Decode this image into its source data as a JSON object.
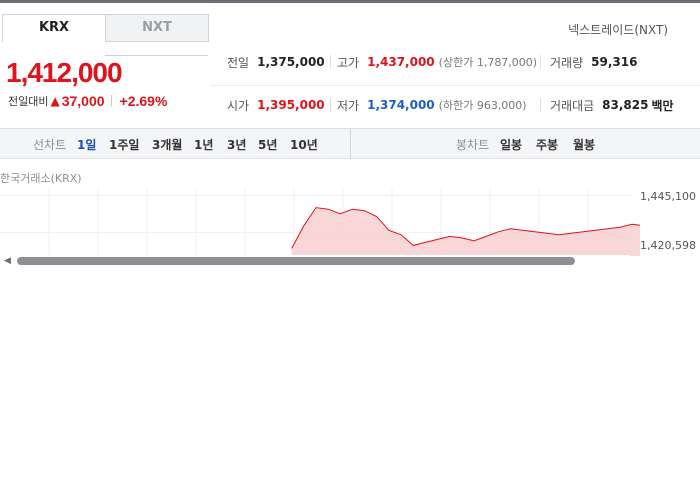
{
  "tabs": [
    {
      "label": "KRX",
      "active": true
    },
    {
      "label": "NXT",
      "active": false
    }
  ],
  "nextrade_label": "넥스트레이드(NXT)",
  "current": {
    "price": "1,412,000",
    "vs_label": "전일대비",
    "change": "37,000",
    "change_pct": "+2.69%",
    "direction": "up"
  },
  "stats": {
    "prev_close": {
      "label": "전일",
      "value": "1,375,000"
    },
    "high": {
      "label": "고가",
      "value": "1,437,000",
      "sub": "(상한가 1,787,000)"
    },
    "volume": {
      "label": "거래량",
      "value": "59,316"
    },
    "open": {
      "label": "시가",
      "value": "1,395,000"
    },
    "low": {
      "label": "저가",
      "value": "1,374,000",
      "sub": "(하한가 963,000)"
    },
    "amount": {
      "label": "거래대금",
      "value": "83,825",
      "unit": "백만"
    }
  },
  "chart_bar": {
    "line_label": "선차트",
    "line_periods": [
      "1일",
      "1주일",
      "3개월",
      "1년",
      "3년",
      "5년",
      "10년"
    ],
    "active_period": "1일",
    "candle_label": "봉차트",
    "candle_periods": [
      "일봉",
      "주봉",
      "월봉"
    ]
  },
  "market_label": "한국거래소(KRX)",
  "y_axis_labels": [
    "1,445,100",
    "1,420,598"
  ],
  "colors": {
    "up": "#e0131a",
    "down": "#1a5fd0",
    "accent": "#1a4fb5"
  },
  "chart_data": {
    "type": "area",
    "title": "",
    "ylim": [
      1405000,
      1450000
    ],
    "y_ticks": [
      1445100,
      1420598
    ],
    "x": [
      0,
      1,
      2,
      3,
      4,
      5,
      6,
      7,
      8,
      9,
      10,
      11,
      12,
      13,
      14,
      15,
      16,
      17,
      18,
      19,
      20,
      21,
      22,
      23,
      24,
      25,
      26,
      27,
      28,
      29,
      30,
      31,
      32,
      33,
      34,
      35
    ],
    "series": [
      {
        "values": [
          1410000,
          1425000,
          1437000,
          1436000,
          1433000,
          1436000,
          1435000,
          1431000,
          1422000,
          1419000,
          1412000,
          1414000,
          1416000,
          1418000,
          1417000,
          1415000,
          1418000,
          1421000,
          1423000,
          1422000,
          1421000,
          1420000,
          1419000,
          1420000,
          1421000,
          1422000,
          1423000,
          1424000,
          1426000,
          1425000,
          1425500,
          1424000,
          1422500,
          1421000,
          1419000,
          1418000
        ]
      }
    ]
  }
}
